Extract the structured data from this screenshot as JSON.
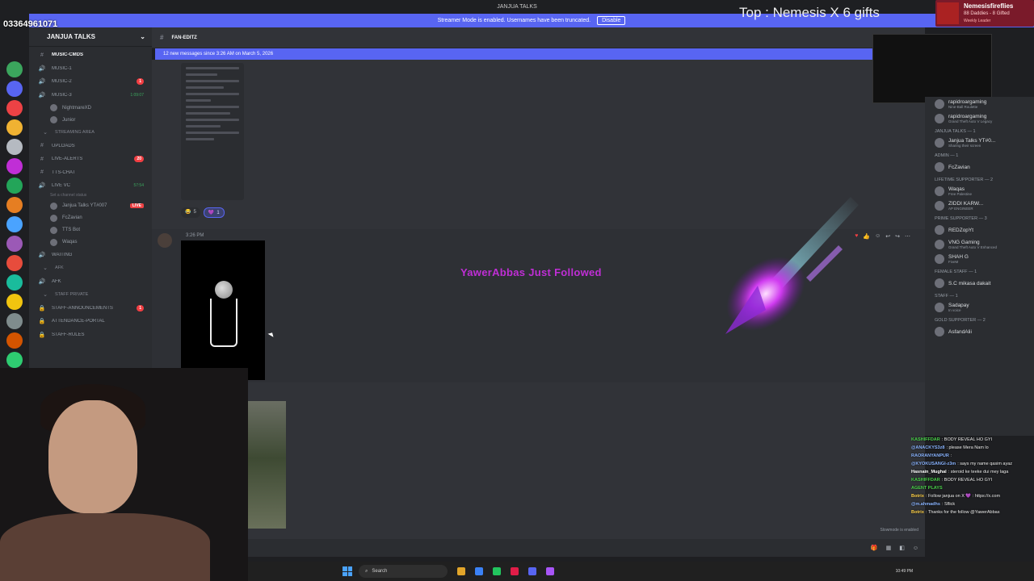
{
  "window": {
    "title": "JANJUA TALKS"
  },
  "streamer_bar": {
    "text": "Streamer Mode is enabled. Usernames have been truncated.",
    "disable_label": "Disable"
  },
  "overlay": {
    "phone": "03364961071",
    "gift_banner": "Top : Nemesis X 6 gifts",
    "follow_alert": "YawerAbbas Just Followed"
  },
  "sub_card": {
    "name": "Nemesisfireflies",
    "subs": "88 Daddies - 8 Gifted",
    "label": "Weekly Leader"
  },
  "server": {
    "name": "JANJUA TALKS"
  },
  "channels": [
    {
      "type": "text",
      "name": "MUSIC-CMDS",
      "bright": true
    },
    {
      "type": "voice",
      "name": "MUSIC-1"
    },
    {
      "type": "voice",
      "name": "MUSIC-2",
      "badge": "1"
    },
    {
      "type": "voice",
      "name": "MUSIC-3",
      "time": "1:09:07"
    }
  ],
  "voice_users_music3": [
    "NightmareXD",
    "Junior"
  ],
  "category_streaming": "STREAMING AREA",
  "channels_streaming": [
    {
      "name": "UPLOADS"
    },
    {
      "name": "LIVE-ALERTS",
      "badge": "20"
    },
    {
      "name": "tts-chat"
    }
  ],
  "live_vc": {
    "name": "LIVE VC",
    "time": "57:54",
    "sub": "Set a channel status"
  },
  "live_vc_users": [
    {
      "name": "Janjua Talks YT#007",
      "live": "LIVE"
    },
    {
      "name": "FcZavian"
    },
    {
      "name": "TTS Bot"
    },
    {
      "name": "Waqas"
    }
  ],
  "waiting": "WAITING",
  "category_afk": "AFK",
  "afk_channel": "AFK",
  "category_staff": "STAFF PRIVATE",
  "staff_channels": [
    {
      "name": "STAFF-ANNOUNCEMENTS",
      "badge": "1"
    },
    {
      "name": "attendance-portal"
    },
    {
      "name": "STAFF-RULES"
    }
  ],
  "chat": {
    "channel": "FAN-EDITZ",
    "new_messages": "12 new messages since 3:26 AM on March 5, 2026",
    "reactions": [
      {
        "emoji": "😂",
        "count": "5"
      },
      {
        "emoji": "💜",
        "count": "1"
      }
    ],
    "msg_time": "3:26 PM",
    "slowmode": "Slowmode is enabled"
  },
  "members": [
    {
      "group": null,
      "items": [
        {
          "name": "rapidroargaming",
          "status": "Nine-Ball Roulette"
        },
        {
          "name": "rapidroargaming",
          "status": "Grand Theft Auto V Legacy"
        }
      ]
    },
    {
      "group": "JANJUA TALKS — 1",
      "items": [
        {
          "name": "Janjua Talks YT#0...",
          "status": "Sharing their screen"
        }
      ]
    },
    {
      "group": "Admin — 1",
      "items": [
        {
          "name": "FcZavian",
          "status": ""
        }
      ]
    },
    {
      "group": "Lifetime Supporter — 2",
      "items": [
        {
          "name": "Waqas",
          "status": "Free Palestine"
        },
        {
          "name": "ZIDDI KARW...",
          "status": "AP ENGINEER"
        }
      ]
    },
    {
      "group": "Prime Supporter — 3",
      "items": [
        {
          "name": "REDZopYt",
          "status": ""
        },
        {
          "name": "VNG Gaming",
          "status": "Grand Theft Auto V Enhanced"
        },
        {
          "name": "SHAH G",
          "status": "FiveM"
        }
      ]
    },
    {
      "group": "Female Staff — 1",
      "items": [
        {
          "name": "S.C mikasa dakait",
          "status": ""
        }
      ]
    },
    {
      "group": "STAFF — 1",
      "items": [
        {
          "name": "Sadapay",
          "status": "In voice"
        }
      ]
    },
    {
      "group": "Gold Supporter — 2",
      "items": [
        {
          "name": "AsfandAlii",
          "status": ""
        }
      ]
    }
  ],
  "overlay_chat": [
    {
      "user": "KASHIFFDAR",
      "text": ": BODY REVEAL HO GYI",
      "color": "#4bd14b"
    },
    {
      "user": "@ANACKYS3z8",
      "text": ": please Mera Nam lo",
      "color": "#8ab4ff"
    },
    {
      "user": "RAORANYANPUR",
      "text": ":",
      "color": "#8ab4ff"
    },
    {
      "user": "@KYOKUSANGI-z3m",
      "text": ": says my name qasim ayaz",
      "color": "#8ab4ff"
    },
    {
      "user": "Hasnain_Mughal",
      "text": ": steroid ke teeke dui mey laga",
      "color": "#ffffff"
    },
    {
      "user": "KASHIFFDAR",
      "text": ": BODY REVEAL HO GYI",
      "color": "#4bd14b"
    },
    {
      "user": "AGENT PLAYS",
      "text": "",
      "color": "#4bd14b"
    },
    {
      "user": "Botrix",
      "text": ": Follow janjua on X 💜 : https://x.com",
      "color": "#ffd24a"
    },
    {
      "user": "@m.ahmadhs",
      "text": ": Sflick",
      "color": "#8ab4ff"
    },
    {
      "user": "Botrix",
      "text": ": Thanks for the follow @YawerAbbas",
      "color": "#ffd24a"
    }
  ],
  "taskbar": {
    "search": "Search",
    "clock": "10:49 PM"
  },
  "colors": {
    "blurple": "#5865f2",
    "alert_purple": "#c02ed6",
    "live_red": "#ed4245"
  }
}
